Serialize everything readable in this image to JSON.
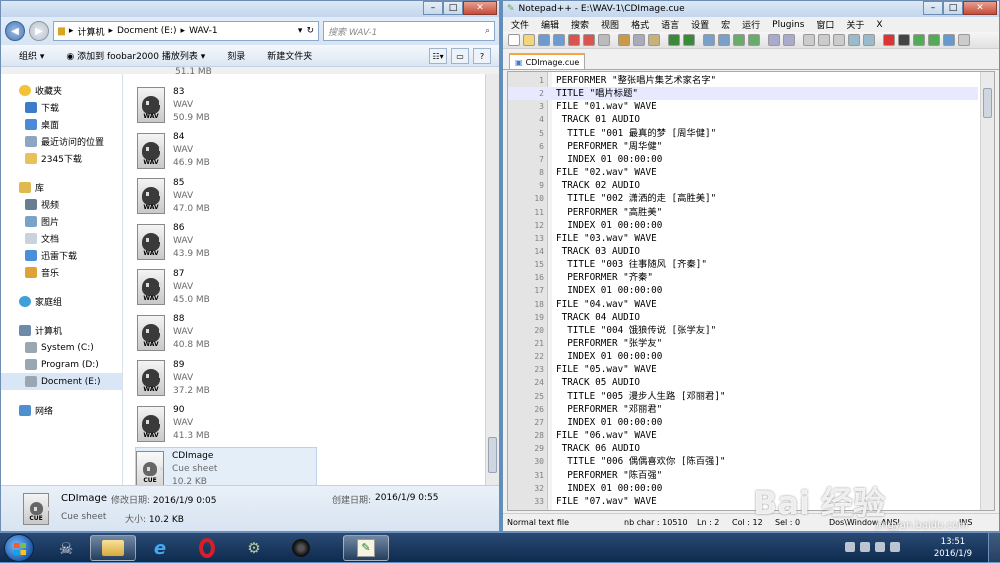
{
  "explorer": {
    "breadcrumb": [
      "计算机",
      "Docment (E:)",
      "WAV-1"
    ],
    "search_placeholder": "搜索 WAV-1",
    "commands": [
      "组织 ▾",
      "添加到 foobar2000 播放列表 ▾",
      "刻录",
      "新建文件夹"
    ],
    "nav": {
      "favorites_head": "收藏夹",
      "favorites": [
        "下载",
        "桌面",
        "最近访问的位置",
        "2345下载"
      ],
      "libraries_head": "库",
      "libraries": [
        "视频",
        "图片",
        "文档",
        "迅雷下载",
        "音乐"
      ],
      "homegroup": "家庭组",
      "computer_head": "计算机",
      "drives": [
        "System (C:)",
        "Program (D:)",
        "Docment (E:)"
      ],
      "network": "网络"
    },
    "partial_top_size": "51.1 MB",
    "files": [
      {
        "name": "83",
        "type": "WAV",
        "size": "50.9 MB"
      },
      {
        "name": "84",
        "type": "WAV",
        "size": "46.9 MB"
      },
      {
        "name": "85",
        "type": "WAV",
        "size": "47.0 MB"
      },
      {
        "name": "86",
        "type": "WAV",
        "size": "43.9 MB"
      },
      {
        "name": "87",
        "type": "WAV",
        "size": "45.0 MB"
      },
      {
        "name": "88",
        "type": "WAV",
        "size": "40.8 MB"
      },
      {
        "name": "89",
        "type": "WAV",
        "size": "37.2 MB"
      },
      {
        "name": "90",
        "type": "WAV",
        "size": "41.3 MB"
      }
    ],
    "selected_file": {
      "name": "CDImage",
      "type": "Cue sheet",
      "size": "10.2 KB"
    },
    "details": {
      "name": "CDImage",
      "modified_label": "修改日期:",
      "modified": "2016/1/9 0:05",
      "created_label": "创建日期:",
      "created": "2016/1/9 0:55",
      "type": "Cue sheet",
      "size_label": "大小:",
      "size": "10.2 KB"
    }
  },
  "notepad": {
    "title": "Notepad++ - E:\\WAV-1\\CDImage.cue",
    "menu": [
      "文件",
      "编辑",
      "搜索",
      "视图",
      "格式",
      "语言",
      "设置",
      "宏",
      "运行",
      "Plugins",
      "窗口",
      "关于",
      "X"
    ],
    "tab": "CDImage.cue",
    "lines": [
      "PERFORMER \"整张唱片集艺术家名字\"",
      "TITLE \"唱片标题\"",
      "FILE \"01.wav\" WAVE",
      " TRACK 01 AUDIO",
      "  TITLE \"001 最真的梦 [周华健]\"",
      "  PERFORMER \"周华健\"",
      "  INDEX 01 00:00:00",
      "FILE \"02.wav\" WAVE",
      " TRACK 02 AUDIO",
      "  TITLE \"002 潇洒的走 [高胜美]\"",
      "  PERFORMER \"高胜美\"",
      "  INDEX 01 00:00:00",
      "FILE \"03.wav\" WAVE",
      " TRACK 03 AUDIO",
      "  TITLE \"003 往事随风 [齐秦]\"",
      "  PERFORMER \"齐秦\"",
      "  INDEX 01 00:00:00",
      "FILE \"04.wav\" WAVE",
      " TRACK 04 AUDIO",
      "  TITLE \"004 饿狼传说 [张学友]\"",
      "  PERFORMER \"张学友\"",
      "  INDEX 01 00:00:00",
      "FILE \"05.wav\" WAVE",
      " TRACK 05 AUDIO",
      "  TITLE \"005 漫步人生路 [邓丽君]\"",
      "  PERFORMER \"邓丽君\"",
      "  INDEX 01 00:00:00",
      "FILE \"06.wav\" WAVE",
      " TRACK 06 AUDIO",
      "  TITLE \"006 偶偶喜欢你 [陈百强]\"",
      "  PERFORMER \"陈百强\"",
      "  INDEX 01 00:00:00",
      "FILE \"07.wav\" WAVE"
    ],
    "status": {
      "lang": "Normal text file",
      "chars": "nb char : 10510",
      "ln": "Ln : 2",
      "col": "Col : 12",
      "sel": "Sel : 0",
      "eol": "Dos\\Window ANSI",
      "mode": "INS"
    }
  },
  "taskbar": {
    "time": "13:51",
    "date": "2016/1/9"
  },
  "watermark": {
    "text": "Bai 经验",
    "url": "jingyan.baidu.com"
  }
}
